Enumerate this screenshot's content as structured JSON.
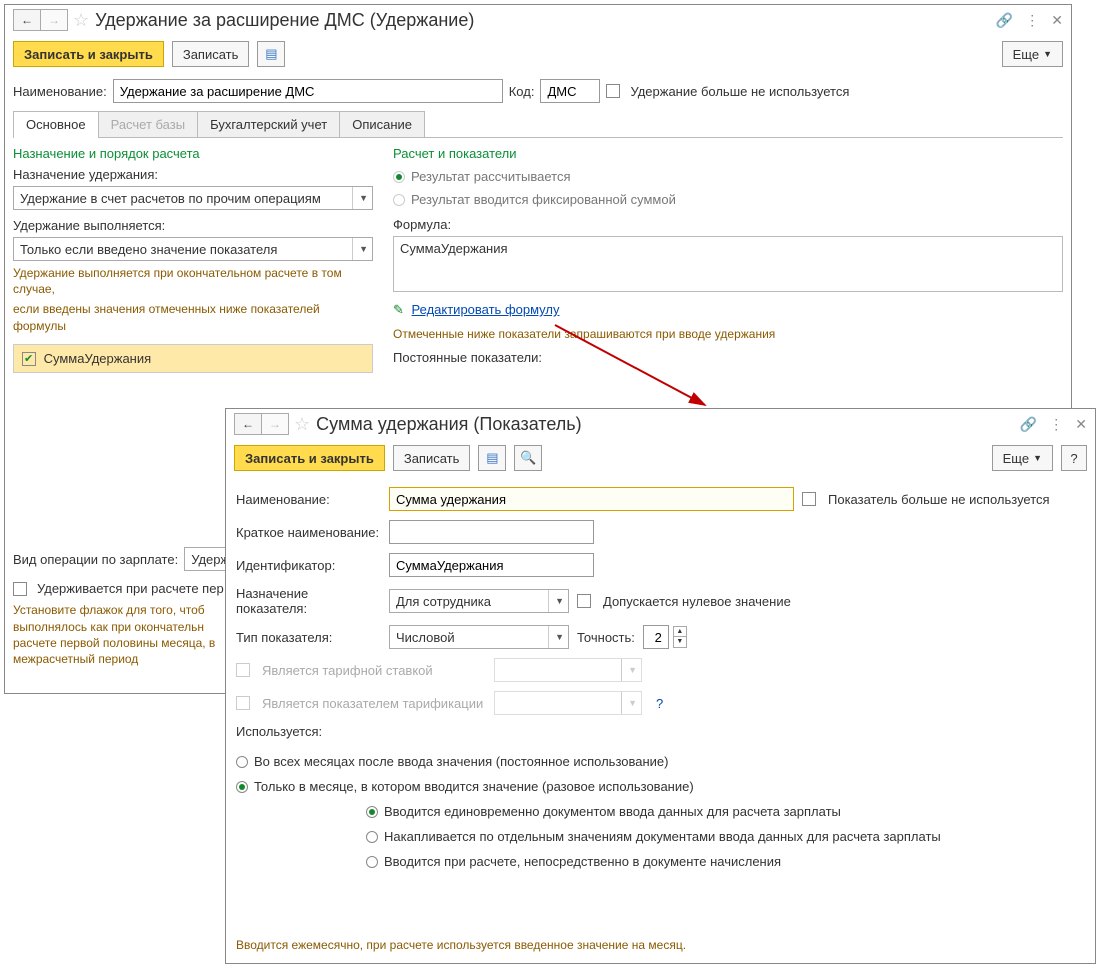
{
  "win1": {
    "title": "Удержание за расширение ДМС (Удержание)",
    "btn_save_close": "Записать и закрыть",
    "btn_save": "Записать",
    "btn_more": "Еще",
    "lbl_name": "Наименование:",
    "input_name": "Удержание за расширение ДМС",
    "lbl_code": "Код:",
    "input_code": "ДМС",
    "chk_not_used": "Удержание больше не используется",
    "tabs": {
      "main": "Основное",
      "base": "Расчет базы",
      "accounting": "Бухгалтерский учет",
      "desc": "Описание"
    },
    "left": {
      "section": "Назначение и порядок расчета",
      "lbl_purpose": "Назначение удержания:",
      "dd_purpose": "Удержание в счет расчетов по прочим операциям",
      "lbl_exec": "Удержание выполняется:",
      "dd_exec": "Только если введено значение показателя",
      "note1": "Удержание выполняется при окончательном расчете в том случае,",
      "note2": "если введены значения отмеченных ниже показателей формулы",
      "indicator": "СуммаУдержания"
    },
    "right": {
      "section": "Расчет и показатели",
      "radio_calc": "Результат рассчитывается",
      "radio_fixed": "Результат вводится фиксированной суммой",
      "lbl_formula": "Формула:",
      "formula": "СуммаУдержания",
      "edit_formula": "Редактировать формулу",
      "note_req": "Отмеченные ниже показатели запрашиваются при вводе удержания",
      "lbl_const": "Постоянные показатели:"
    },
    "bottom": {
      "lbl_operation": "Вид операции по зарплате:",
      "dd_operation": "Удерж",
      "chk_first_half": "Удерживается при расчете пер",
      "help_text": "Установите флажок для того, чтоб выполнялось как при окончательн расчете первой половины месяца, в межрасчетный период"
    }
  },
  "win2": {
    "title": "Сумма удержания (Показатель)",
    "btn_save_close": "Записать и закрыть",
    "btn_save": "Записать",
    "btn_more": "Еще",
    "lbl_name": "Наименование:",
    "input_name": "Сумма удержания",
    "chk_not_used": "Показатель больше не используется",
    "lbl_short": "Краткое наименование:",
    "lbl_id": "Идентификатор:",
    "input_id": "СуммаУдержания",
    "lbl_purpose": "Назначение показателя:",
    "dd_purpose": "Для сотрудника",
    "chk_zero": "Допускается нулевое значение",
    "lbl_type": "Тип показателя:",
    "dd_type": "Числовой",
    "lbl_precision": "Точность:",
    "input_precision": "2",
    "chk_tariff_rate": "Является тарифной ставкой",
    "chk_tariff_ind": "Является показателем тарификации",
    "lbl_used": "Используется:",
    "radio_all": "Во всех месяцах после ввода значения (постоянное использование)",
    "radio_once": "Только в месяце, в котором вводится значение (разовое использование)",
    "sub1": "Вводится единовременно документом ввода данных для расчета зарплаты",
    "sub2": "Накапливается по отдельным значениям документами ввода данных для расчета зарплаты",
    "sub3": "Вводится при расчете, непосредственно в документе начисления",
    "footer": "Вводится ежемесячно, при расчете используется введенное значение на месяц."
  }
}
